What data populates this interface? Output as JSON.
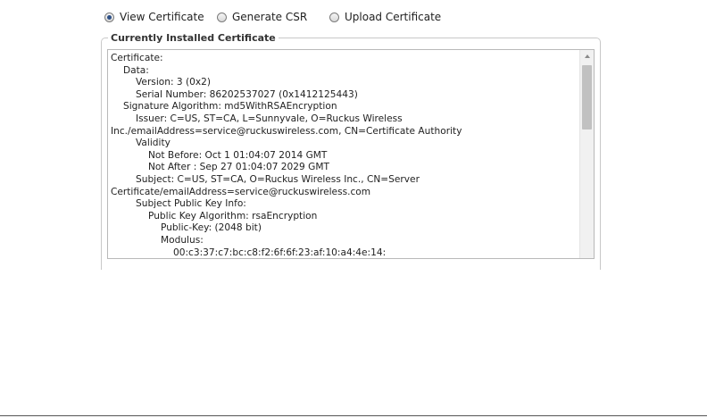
{
  "cert_mode": {
    "options": [
      {
        "label": "View Certificate",
        "checked": true
      },
      {
        "label": "Generate CSR",
        "checked": false
      },
      {
        "label": "Upload Certificate",
        "checked": false
      }
    ]
  },
  "installed": {
    "legend": "Currently Installed Certificate",
    "lines": [
      "Certificate:",
      "Data:",
      "Version: 3 (0x2)",
      "Serial Number: 86202537027 (0x1412125443)",
      "Signature Algorithm: md5WithRSAEncryption",
      "Issuer: C=US, ST=CA, L=Sunnyvale, O=Ruckus Wireless",
      "Inc./emailAddress=service@ruckuswireless.com, CN=Certificate Authority",
      "Validity",
      "Not Before: Oct  1 01:04:07 2014 GMT",
      "Not After : Sep 27 01:04:07 2029 GMT",
      "Subject: C=US, ST=CA, O=Ruckus Wireless Inc., CN=Server",
      "Certificate/emailAddress=service@ruckuswireless.com",
      "Subject Public Key Info:",
      "Public Key Algorithm: rsaEncryption",
      "Public-Key: (2048 bit)",
      "Modulus:",
      "00:c3:37:c7:bc:c8:f2:6f:6f:23:af:10:a4:4e:14:"
    ]
  },
  "colors": {
    "radio_dot": "#2d4f86",
    "border": "#c8c8c8",
    "scroll_thumb": "#c1c1c1"
  }
}
